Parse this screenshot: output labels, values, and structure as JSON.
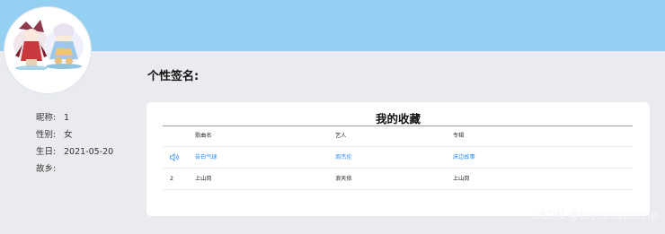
{
  "profile": {
    "nickname_label": "昵称:",
    "nickname": "1",
    "gender_label": "性别:",
    "gender": "女",
    "birthday_label": "生日:",
    "birthday": "2021-05-20",
    "hometown_label": "故乡:",
    "hometown": ""
  },
  "signature_label": "个性签名:",
  "favorites": {
    "title": "我的收藏",
    "columns": [
      "歌曲名",
      "艺人",
      "专辑"
    ],
    "rows": [
      {
        "index": "",
        "song": "告白气球",
        "artist": "周杰伦",
        "album": "床边故事",
        "playing": true
      },
      {
        "index": "2",
        "song": "上山岗",
        "artist": "浪天依",
        "album": "上山岗",
        "playing": false
      }
    ]
  },
  "watermark": "CSDN @biyezuopinvip",
  "colors": {
    "header": "#95d0f3",
    "page_bg": "#e9ebee",
    "accent": "#2d8cf0"
  },
  "icons": {
    "playing": "speaker-icon"
  }
}
